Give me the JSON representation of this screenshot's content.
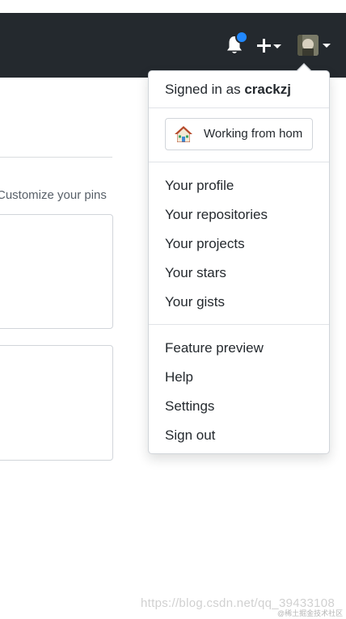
{
  "header": {
    "icons": [
      "bell-icon",
      "plus-icon",
      "chevron-down-icon",
      "avatar"
    ],
    "notification_dot_color": "#2188ff",
    "background_color": "#24292e"
  },
  "main": {
    "customize_pins": "Customize your pins"
  },
  "dropdown": {
    "signed_in_prefix": "Signed in as",
    "username": "crackzj",
    "status": {
      "emoji_icon": "house-icon",
      "text": "Working from hom"
    },
    "group_one": [
      "Your profile",
      "Your repositories",
      "Your projects",
      "Your stars",
      "Your gists"
    ],
    "group_two": [
      "Feature preview",
      "Help",
      "Settings",
      "Sign out"
    ]
  },
  "watermark": {
    "url": "https://blog.csdn.net/qq_39433108",
    "brand": "@稀土掘金技术社区"
  }
}
